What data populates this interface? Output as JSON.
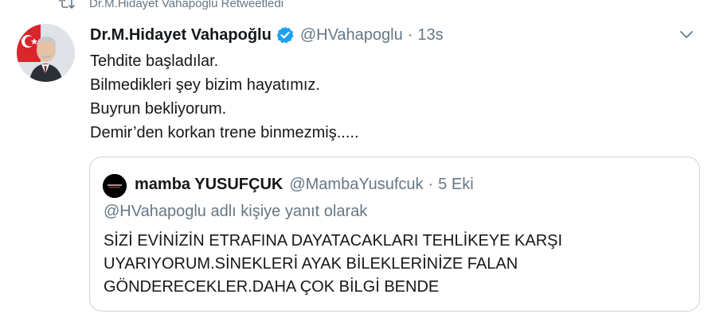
{
  "retweet_context": {
    "icon": "retweet-icon",
    "text": "Dr.M.Hidayet Vahapoğlu Retweetledi"
  },
  "tweet": {
    "author_name": "Dr.M.Hidayet Vahapoğlu",
    "verified": true,
    "handle": "@HVahapoglu",
    "separator": "·",
    "time": "13s",
    "lines": [
      "Tehdite başladılar.",
      "Bilmedikleri şey bizim hayatımız.",
      "Buyrun bekliyorum.",
      "Demir’den korkan trene binmezmiş....."
    ]
  },
  "quoted_tweet": {
    "author_name": "mamba YUSUFÇUK",
    "handle": "@MambaYusufcuk",
    "separator": "·",
    "time": "5 Eki",
    "reply_context": "@HVahapoglu adlı kişiye yanıt olarak",
    "lines": [
      "SİZİ EVİNİZİN ETRAFINA DAYATACAKLARI TEHLİKEYE KARŞI",
      "UYARIYORUM.SİNEKLERİ AYAK BİLEKLERİNİZE FALAN",
      "GÖNDERECEKLER.DAHA ÇOK BİLGİ BENDE"
    ]
  },
  "colors": {
    "text_primary": "#14171a",
    "text_secondary": "#657786",
    "verified_blue": "#1da1f2",
    "border": "#ccd6dd"
  }
}
